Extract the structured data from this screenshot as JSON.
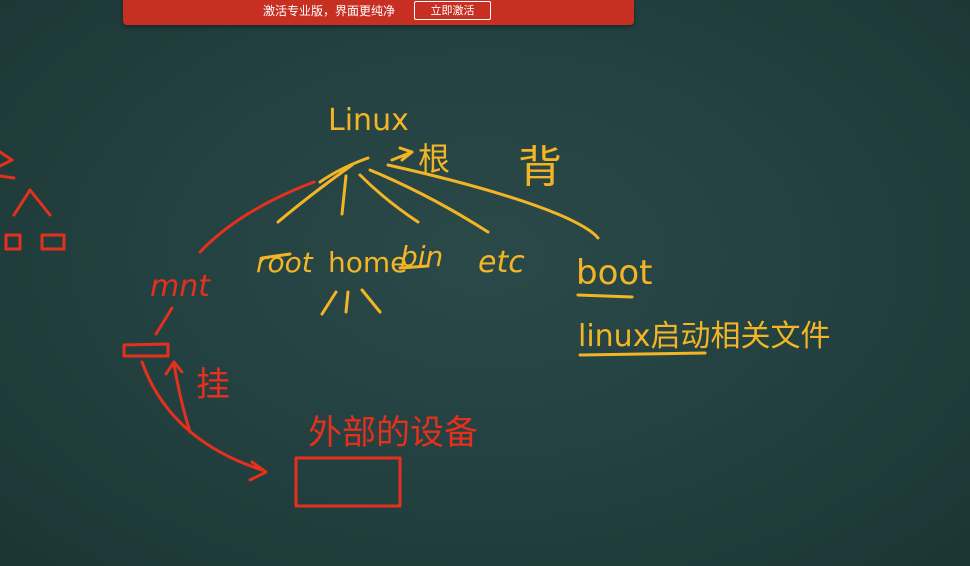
{
  "banner": {
    "message": "激活专业版，界面更纯净",
    "button_label": "立即激活",
    "background_color": "#c62f22"
  },
  "board": {
    "background_color": "#22403f",
    "yellow_chalk_color": "#f3b526",
    "red_chalk_color": "#e5301d",
    "yellow_labels": {
      "linux": "Linux",
      "root_note": "根",
      "back_note": "背",
      "root": "root",
      "home": "home",
      "bin": "bin",
      "etc": "etc",
      "boot": "boot",
      "boot_note": "linux启动相关文件"
    },
    "red_labels": {
      "mnt": "mnt",
      "mount_note": "挂",
      "external_device": "外部的设备"
    }
  }
}
